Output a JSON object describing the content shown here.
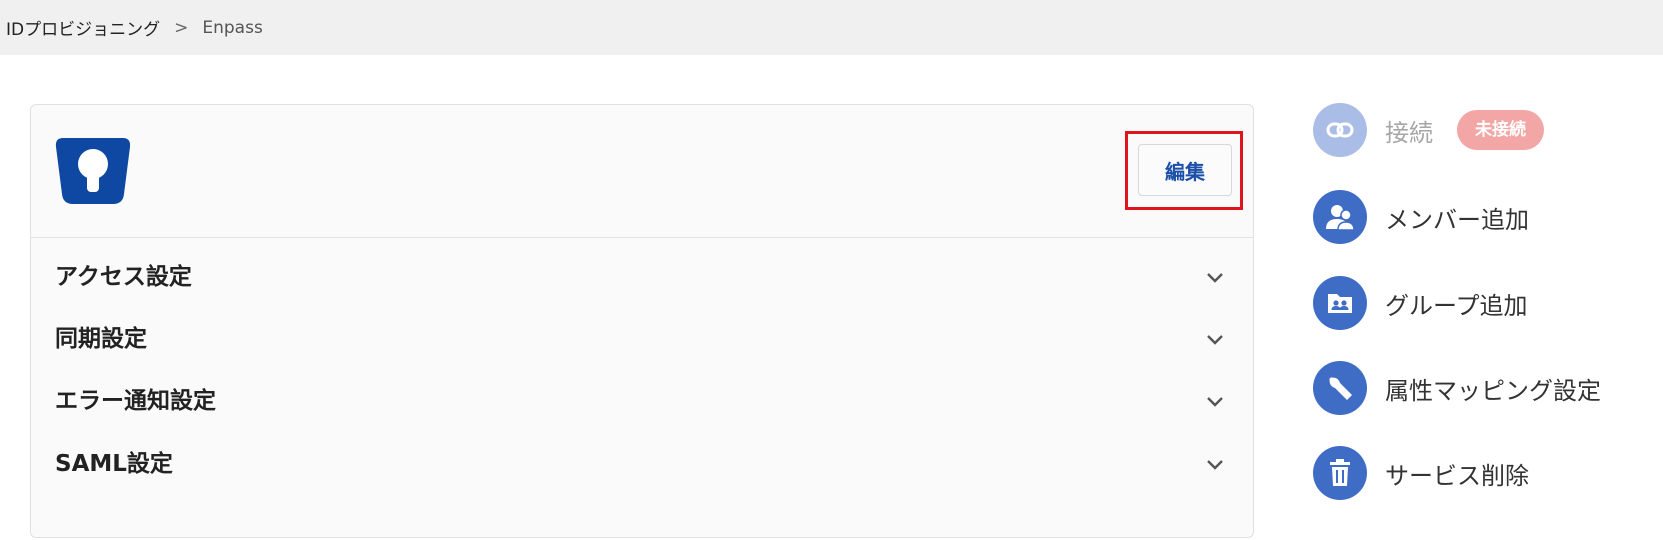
{
  "breadcrumb": {
    "parent": "IDプロビジョニング",
    "separator": ">",
    "current": "Enpass"
  },
  "card": {
    "logo_icon": "enpass-keyhole-logo",
    "edit_label": "編集",
    "sections": [
      {
        "label": "アクセス設定"
      },
      {
        "label": "同期設定"
      },
      {
        "label": "エラー通知設定"
      },
      {
        "label": "SAML設定"
      }
    ]
  },
  "sidebar": {
    "connect": {
      "label": "接続",
      "status": "未接続",
      "icon": "link-icon"
    },
    "add_member": {
      "label": "メンバー追加",
      "icon": "users-icon"
    },
    "add_group": {
      "label": "グループ追加",
      "icon": "group-folder-icon"
    },
    "attribute_mapping": {
      "label": "属性マッピング設定",
      "icon": "wrench-icon"
    },
    "delete_service": {
      "label": "サービス削除",
      "icon": "trash-icon"
    }
  },
  "colors": {
    "accent": "#3f6cc5",
    "highlight": "#e0141e",
    "badge": "#f2a6a6",
    "logo": "#0f48a2"
  }
}
